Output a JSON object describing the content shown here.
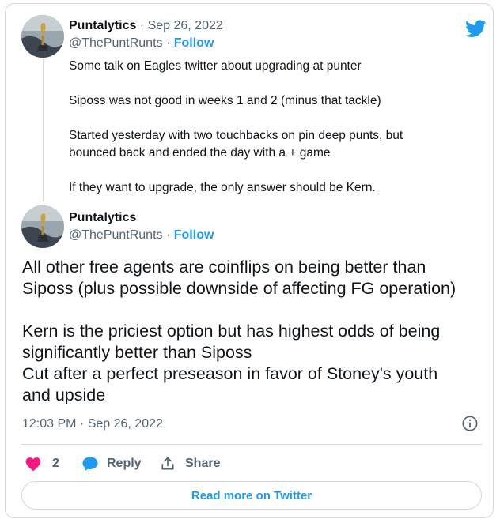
{
  "colors": {
    "accent": "#1d9bf0",
    "heart": "#f91880",
    "text": "#0f1419",
    "muted": "#536471",
    "border": "#cfd9de"
  },
  "tweet1": {
    "display_name": "Puntalytics",
    "date_sep": " · ",
    "date": "Sep 26, 2022",
    "handle": "@ThePuntRunts",
    "follow_sep": " · ",
    "follow": "Follow",
    "lines": [
      "Some talk on Eagles twitter about upgrading at punter",
      "Siposs was not good in weeks 1 and 2 (minus that tackle)",
      "Started yesterday with two touchbacks on pin deep punts, but",
      "bounced back and ended the day with a + game",
      "If they want to upgrade, the only answer should be Kern."
    ]
  },
  "tweet2": {
    "display_name": "Puntalytics",
    "handle": "@ThePuntRunts",
    "follow_sep": " · ",
    "follow": "Follow",
    "lines": [
      "All other free agents are coinflips on being better than",
      "Siposs (plus possible downside of affecting FG operation)",
      "Kern is the priciest option but  has highest odds of being",
      "significantly better than Siposs",
      "Cut after a perfect preseason in favor of Stoney's youth",
      "and upside"
    ],
    "timestamp": "12:03 PM · Sep 26, 2022"
  },
  "actions": {
    "like_count": "2",
    "reply_label": "Reply",
    "share_label": "Share"
  },
  "read_more": "Read more on Twitter",
  "icons": {
    "logo": "twitter-bird-icon",
    "info": "info-icon",
    "like": "heart-icon",
    "reply": "reply-bubble-icon",
    "share": "share-icon"
  }
}
